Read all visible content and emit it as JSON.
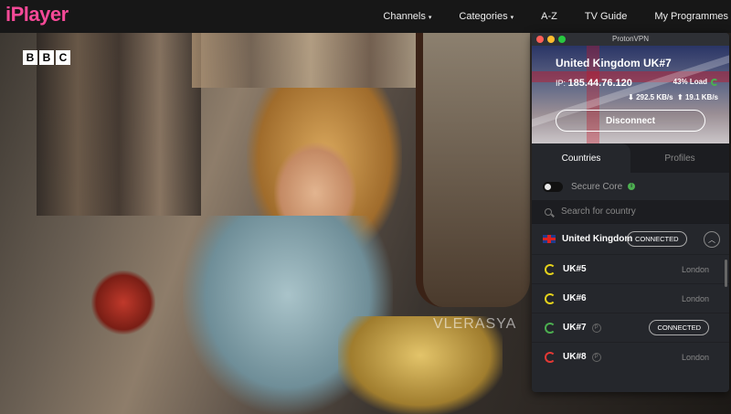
{
  "iplayer": {
    "logo": "iPlayer",
    "nav": [
      {
        "label": "Channels",
        "caret": "▾"
      },
      {
        "label": "Categories",
        "caret": "▾"
      },
      {
        "label": "A-Z",
        "caret": ""
      },
      {
        "label": "TV Guide",
        "caret": ""
      },
      {
        "label": "My Programmes",
        "caret": ""
      }
    ]
  },
  "video": {
    "channel_letters": [
      "B",
      "B",
      "C"
    ],
    "watermark": "VLERASYA",
    "next_arrow": "›"
  },
  "vpn": {
    "window_title": "ProtonVPN",
    "server_name": "United Kingdom UK#7",
    "ip_label": "IP:",
    "ip_value": "185.44.76.120",
    "load": "43% Load",
    "download": "292.5 KB/s",
    "upload": "19.1 KB/s",
    "disconnect_label": "Disconnect",
    "tabs": [
      {
        "label": "Countries",
        "active": true
      },
      {
        "label": "Profiles",
        "active": false
      }
    ],
    "secure_core_label": "Secure Core",
    "search_placeholder": "Search for country",
    "country": {
      "name": "United Kingdom",
      "status": "CONNECTED"
    },
    "servers": [
      {
        "name": "UK#5",
        "city": "London",
        "status": "",
        "load_color": "#e5d21b",
        "plus": false
      },
      {
        "name": "UK#6",
        "city": "London",
        "status": "",
        "load_color": "#e5d21b",
        "plus": false
      },
      {
        "name": "UK#7",
        "city": "",
        "status": "CONNECTED",
        "load_color": "#4caf50",
        "plus": true
      },
      {
        "name": "UK#8",
        "city": "London",
        "status": "",
        "load_color": "#e53935",
        "plus": true
      }
    ],
    "colors": {
      "accent": "#4caf50",
      "background": "#25272c"
    }
  }
}
